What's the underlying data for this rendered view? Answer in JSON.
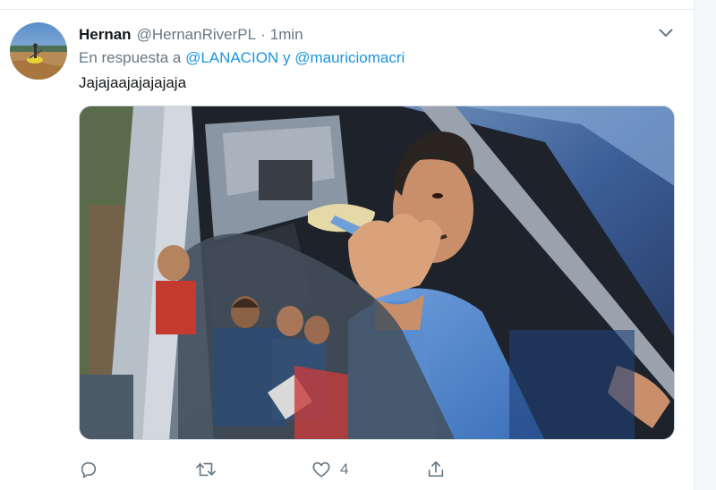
{
  "tweet": {
    "display_name": "Hernan",
    "handle": "@HernanRiverPL",
    "separator": "·",
    "time": "1min",
    "reply_prefix": "En respuesta a",
    "reply_mention_1": "@LANACION",
    "reply_conjunction": "y",
    "reply_mention_2": "@mauriciomacri",
    "text": "Jajajaajajajajaja"
  },
  "actions": {
    "reply": {
      "icon": "reply-icon",
      "count": ""
    },
    "retweet": {
      "icon": "retweet-icon",
      "count": ""
    },
    "like": {
      "icon": "heart-icon",
      "count": "4"
    },
    "share": {
      "icon": "share-icon",
      "count": ""
    }
  },
  "colors": {
    "link": "#1b95e0",
    "secondary_text": "#657786",
    "primary_text": "#14171a",
    "border": "#e6ecf0"
  }
}
